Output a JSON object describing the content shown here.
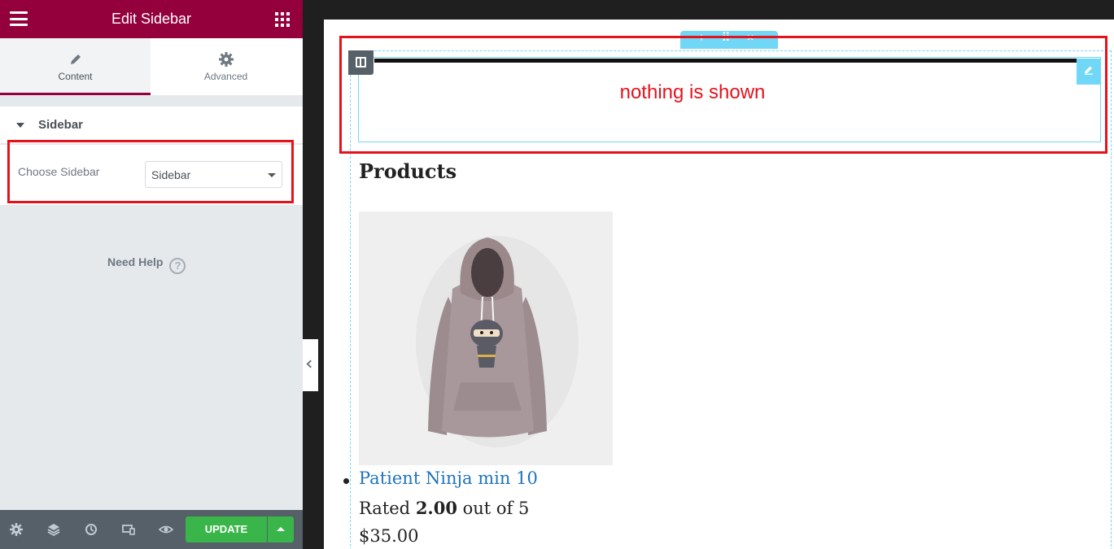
{
  "header": {
    "title": "Edit Sidebar",
    "menu_icon": "hamburger-icon",
    "apps_icon": "grid-icon"
  },
  "tabs": [
    {
      "label": "Content",
      "icon": "pencil-icon",
      "active": true
    },
    {
      "label": "Advanced",
      "icon": "gear-icon",
      "active": false
    }
  ],
  "section": {
    "label": "Sidebar"
  },
  "control": {
    "label": "Choose Sidebar",
    "value": "Sidebar"
  },
  "help": {
    "label": "Need Help",
    "icon_glyph": "?"
  },
  "footer": {
    "icons": [
      "settings-icon",
      "layers-icon",
      "history-icon",
      "responsive-icon",
      "preview-eye-icon"
    ],
    "update_label": "UPDATE"
  },
  "colors": {
    "brand": "#93003c",
    "update": "#39b54a",
    "highlight": "#e5121c",
    "editor_accent": "#71d7f7",
    "link": "#1e73be"
  },
  "preview": {
    "section_controls": "+ ⠿ ×",
    "annotation": "nothing is shown",
    "products_heading": "Products",
    "product": {
      "name": "Patient Ninja min 10",
      "rating_prefix": "Rated ",
      "rating_value": "2.00",
      "rating_suffix": " out of 5",
      "price": "$35.00"
    }
  }
}
